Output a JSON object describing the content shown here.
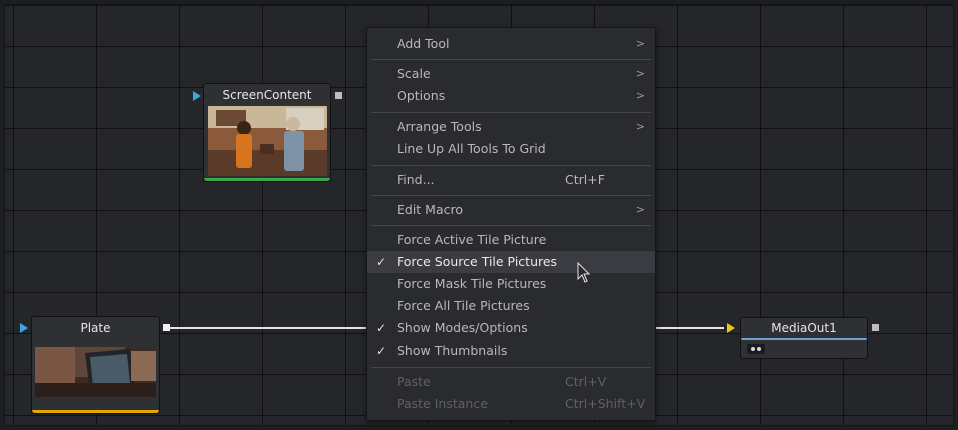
{
  "nodes": {
    "screen_content": {
      "title": "ScreenContent"
    },
    "plate": {
      "title": "Plate"
    },
    "media_out": {
      "title": "MediaOut1"
    }
  },
  "menu": {
    "add_tool": "Add Tool",
    "scale": "Scale",
    "options": "Options",
    "arrange_tools": "Arrange Tools",
    "line_up": "Line Up All Tools To Grid",
    "find": "Find...",
    "find_shortcut": "Ctrl+F",
    "edit_macro": "Edit Macro",
    "force_active": "Force Active Tile Picture",
    "force_source": "Force Source Tile Pictures",
    "force_mask": "Force Mask Tile Pictures",
    "force_all": "Force All Tile Pictures",
    "show_modes": "Show Modes/Options",
    "show_thumbnails": "Show Thumbnails",
    "paste": "Paste",
    "paste_shortcut": "Ctrl+V",
    "paste_instance": "Paste Instance",
    "paste_instance_shortcut": "Ctrl+Shift+V",
    "submenu_glyph": ">",
    "check_glyph": "✓"
  },
  "colors": {
    "input_arrow": "#3aa6e8",
    "output_arrow": "#f0c419",
    "screen_bar": "#3fa648",
    "plate_bar": "#e0a800",
    "mediaout_bar": "#6d9fd6"
  }
}
